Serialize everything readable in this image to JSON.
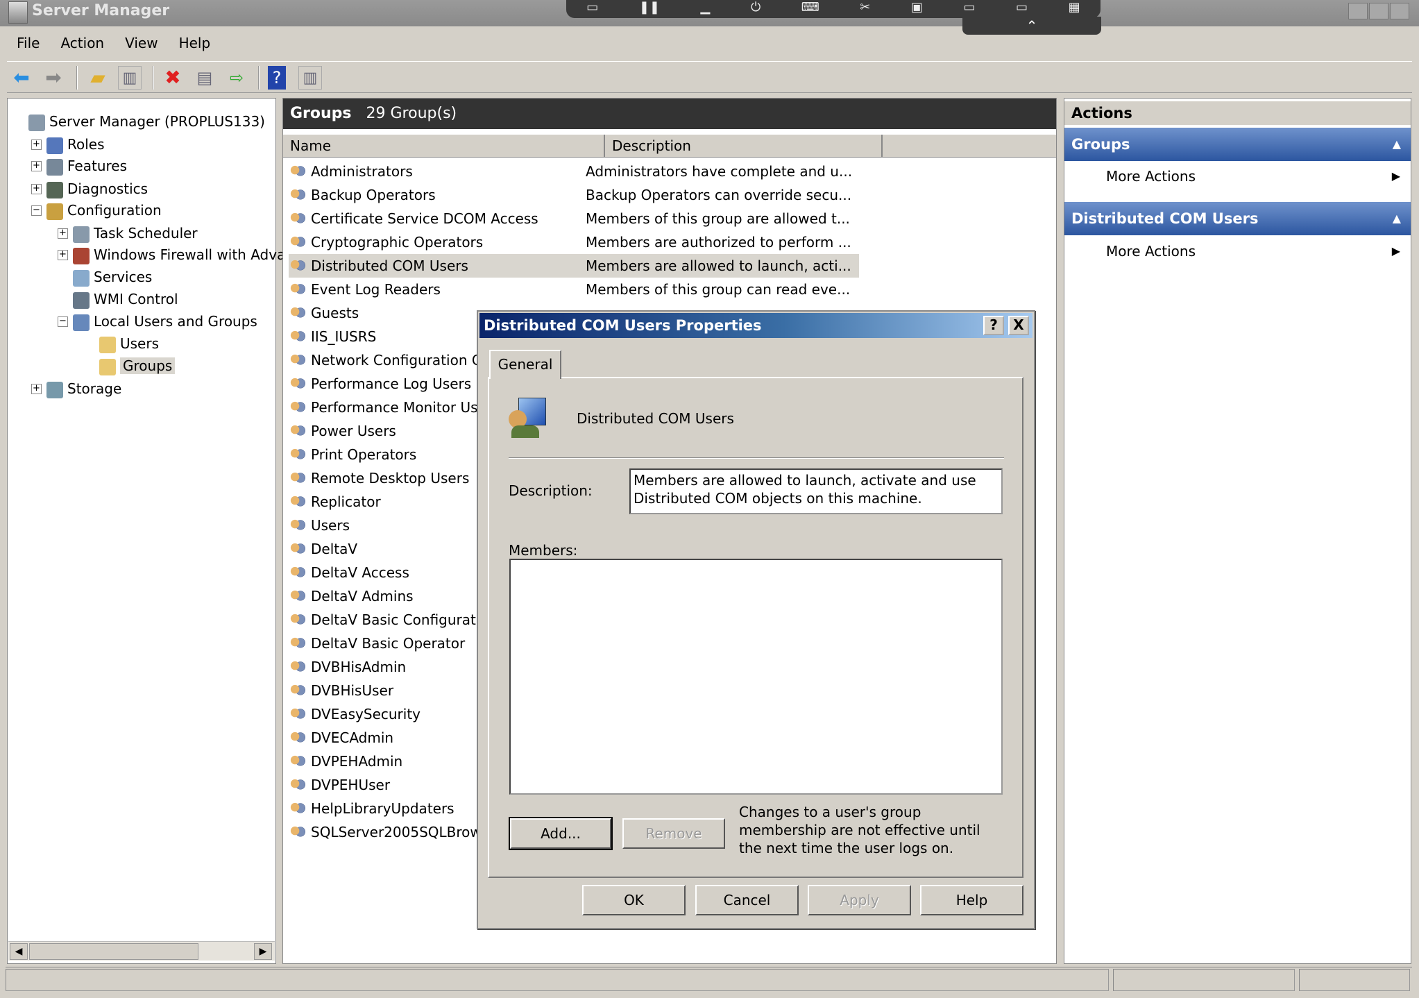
{
  "window": {
    "title": "Server Manager"
  },
  "remote_bar": {
    "icons": [
      "monitor-icon",
      "pause-icon",
      "minimize-icon",
      "power-icon",
      "keyboard-icon",
      "tools-icon",
      "clipboard-icon",
      "display-icon",
      "display-icon",
      "grid-icon"
    ],
    "collapse_glyph": "⌃"
  },
  "menu": [
    "File",
    "Action",
    "View",
    "Help"
  ],
  "toolbar": {
    "icons": [
      "back-arrow-icon",
      "forward-arrow-icon",
      "up-folder-icon",
      "show-hide-tree-icon",
      "delete-icon",
      "properties-icon",
      "export-list-icon",
      "help-icon",
      "show-hide-action-pane-icon"
    ]
  },
  "tree": [
    {
      "label": "Server Manager (PROPLUS133)",
      "level": 0,
      "expander": ""
    },
    {
      "label": "Roles",
      "level": 1,
      "expander": "+"
    },
    {
      "label": "Features",
      "level": 1,
      "expander": "+"
    },
    {
      "label": "Diagnostics",
      "level": 1,
      "expander": "+"
    },
    {
      "label": "Configuration",
      "level": 1,
      "expander": "−"
    },
    {
      "label": "Task Scheduler",
      "level": 2,
      "expander": "+"
    },
    {
      "label": "Windows Firewall with Adva",
      "level": 2,
      "expander": "+"
    },
    {
      "label": "Services",
      "level": 2,
      "expander": ""
    },
    {
      "label": "WMI Control",
      "level": 2,
      "expander": ""
    },
    {
      "label": "Local Users and Groups",
      "level": 2,
      "expander": "−"
    },
    {
      "label": "Users",
      "level": 3,
      "expander": ""
    },
    {
      "label": "Groups",
      "level": 3,
      "expander": "",
      "selected": true
    },
    {
      "label": "Storage",
      "level": 1,
      "expander": "+"
    }
  ],
  "center": {
    "title": "Groups",
    "count": "29 Group(s)",
    "columns": [
      "Name",
      "Description"
    ],
    "rows": [
      {
        "name": "Administrators",
        "desc": "Administrators have complete and u..."
      },
      {
        "name": "Backup Operators",
        "desc": "Backup Operators can override secu..."
      },
      {
        "name": "Certificate Service DCOM Access",
        "desc": "Members of this group are allowed t..."
      },
      {
        "name": "Cryptographic Operators",
        "desc": "Members are authorized to perform ..."
      },
      {
        "name": "Distributed COM Users",
        "desc": "Members are allowed to launch, acti...",
        "selected": true
      },
      {
        "name": "Event Log Readers",
        "desc": "Members of this group can read eve..."
      },
      {
        "name": "Guests",
        "desc": ""
      },
      {
        "name": "IIS_IUSRS",
        "desc": ""
      },
      {
        "name": "Network Configuration C",
        "desc": ""
      },
      {
        "name": "Performance Log Users",
        "desc": ""
      },
      {
        "name": "Performance Monitor Us",
        "desc": ""
      },
      {
        "name": "Power Users",
        "desc": ""
      },
      {
        "name": "Print Operators",
        "desc": ""
      },
      {
        "name": "Remote Desktop Users",
        "desc": ""
      },
      {
        "name": "Replicator",
        "desc": ""
      },
      {
        "name": "Users",
        "desc": ""
      },
      {
        "name": "DeltaV",
        "desc": ""
      },
      {
        "name": "DeltaV Access",
        "desc": ""
      },
      {
        "name": "DeltaV Admins",
        "desc": ""
      },
      {
        "name": "DeltaV Basic Configuratio",
        "desc": ""
      },
      {
        "name": "DeltaV Basic Operator",
        "desc": ""
      },
      {
        "name": "DVBHisAdmin",
        "desc": ""
      },
      {
        "name": "DVBHisUser",
        "desc": ""
      },
      {
        "name": "DVEasySecurity",
        "desc": ""
      },
      {
        "name": "DVECAdmin",
        "desc": ""
      },
      {
        "name": "DVPEHAdmin",
        "desc": ""
      },
      {
        "name": "DVPEHUser",
        "desc": ""
      },
      {
        "name": "HelpLibraryUpdaters",
        "desc": ""
      },
      {
        "name": "SQLServer2005SQLBrow",
        "desc": ""
      }
    ]
  },
  "actions": {
    "title": "Actions",
    "sections": [
      {
        "title": "Groups",
        "item": "More Actions"
      },
      {
        "title": "Distributed COM Users",
        "item": "More Actions"
      }
    ]
  },
  "dialog": {
    "title": "Distributed COM Users Properties",
    "help_glyph": "?",
    "close_glyph": "X",
    "tab": "General",
    "group_name": "Distributed COM Users",
    "description_label": "Description:",
    "description_value": "Members are allowed to launch, activate and use Distributed COM objects on this machine.",
    "members_label": "Members:",
    "members": [],
    "add": "Add...",
    "remove": "Remove",
    "note": "Changes to a user's group membership are not effective until the next time the user logs on.",
    "ok": "OK",
    "cancel": "Cancel",
    "apply": "Apply",
    "help": "Help"
  },
  "colors": {
    "selection": "#d9d6cf",
    "action_header": "#2c56a0",
    "dialog_title": "#0a246a"
  }
}
